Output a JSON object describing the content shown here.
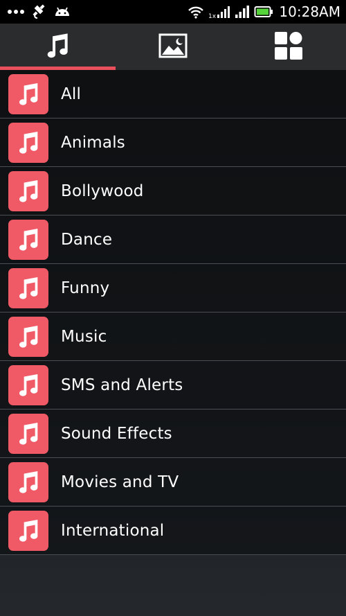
{
  "status_bar": {
    "time": "10:28AM",
    "network_badge": "1x",
    "icons": [
      "overflow-dots-icon",
      "satellite-icon",
      "android-icon",
      "wifi-icon",
      "data-signal-icon",
      "cell-signal-icon",
      "battery-icon"
    ]
  },
  "tabs": [
    {
      "icon": "music-note-icon",
      "active": true
    },
    {
      "icon": "image-icon",
      "active": false
    },
    {
      "icon": "apps-grid-icon",
      "active": false
    }
  ],
  "categories": [
    {
      "label": "All"
    },
    {
      "label": "Animals"
    },
    {
      "label": "Bollywood"
    },
    {
      "label": "Dance"
    },
    {
      "label": "Funny"
    },
    {
      "label": "Music"
    },
    {
      "label": "SMS and Alerts"
    },
    {
      "label": "Sound Effects"
    },
    {
      "label": "Movies and TV"
    },
    {
      "label": "International"
    }
  ],
  "colors": {
    "accent": "#ea4f5c",
    "icon_tile": "#ef5a66",
    "status_bar": "#000000",
    "tab_bar": "#2a2c2e",
    "battery": "#56d23a"
  }
}
